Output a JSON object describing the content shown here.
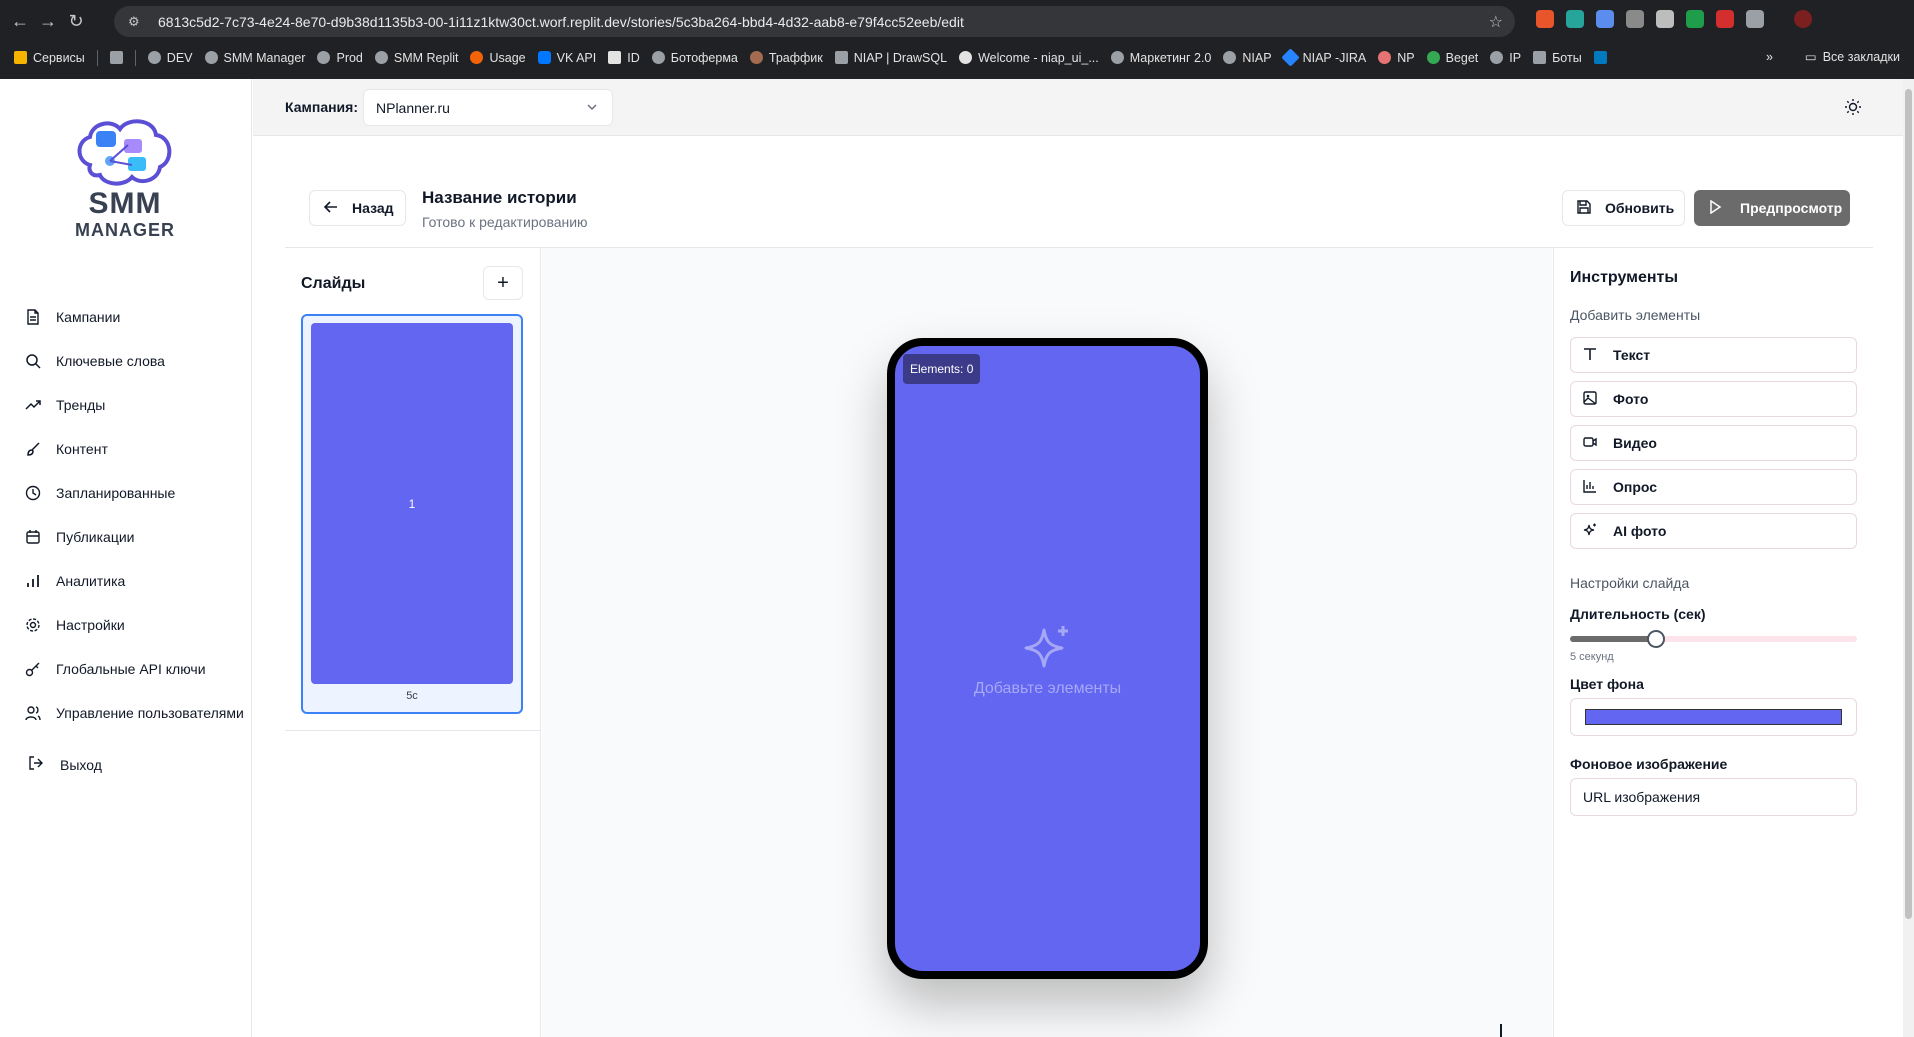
{
  "browser": {
    "url": "6813c5d2-7c73-4e24-8e70-d9b38d1135b3-00-1i11z1ktw30ct.worf.replit.dev/stories/5c3ba264-bbd4-4d32-aab8-e79f4cc52eeb/edit",
    "bookmarks": [
      "Сервисы",
      "DEV",
      "SMM Manager",
      "Prod",
      "SMM Replit",
      "Usage",
      "VK API",
      "ID",
      "Ботоферма",
      "Траффик",
      "NIAP | DrawSQL",
      "Welcome - niap_ui_...",
      "Маркетинг 2.0",
      "NIAP",
      "NIAP -JIRA",
      "NP",
      "Beget",
      "IP",
      "Боты"
    ],
    "all_bookmarks": "Все закладки"
  },
  "sidebar": {
    "logo": {
      "line1": "SMM",
      "line2": "MANAGER"
    },
    "items": [
      {
        "label": "Кампании",
        "icon": "file-icon"
      },
      {
        "label": "Ключевые слова",
        "icon": "search-icon"
      },
      {
        "label": "Тренды",
        "icon": "trending-icon"
      },
      {
        "label": "Контент",
        "icon": "brush-icon"
      },
      {
        "label": "Запланированные",
        "icon": "clock-icon"
      },
      {
        "label": "Публикации",
        "icon": "calendar-icon"
      },
      {
        "label": "Аналитика",
        "icon": "bar-chart-icon"
      },
      {
        "label": "Настройки",
        "icon": "gear-icon"
      },
      {
        "label": "Глобальные API ключи",
        "icon": "key-icon"
      },
      {
        "label": "Управление пользователями",
        "icon": "users-icon"
      }
    ],
    "logout": "Выход"
  },
  "topbar": {
    "campaign_label": "Кампания:",
    "campaign_value": "NPlanner.ru"
  },
  "header": {
    "back_label": "Назад",
    "title": "Название истории",
    "status": "Готово к редактированию",
    "update_label": "Обновить",
    "preview_label": "Предпросмотр"
  },
  "slides": {
    "title": "Слайды",
    "add_label": "+",
    "items": [
      {
        "number": "1",
        "duration": "5с",
        "color": "#6366f1"
      }
    ]
  },
  "canvas": {
    "elements_badge": "Elements: 0",
    "empty_message": "Добавьте элементы",
    "background": "#6366f1"
  },
  "tools": {
    "title": "Инструменты",
    "add_elements_label": "Добавить элементы",
    "buttons": [
      {
        "label": "Текст",
        "icon": "text-icon"
      },
      {
        "label": "Фото",
        "icon": "image-icon"
      },
      {
        "label": "Видео",
        "icon": "video-icon"
      },
      {
        "label": "Опрос",
        "icon": "poll-icon"
      },
      {
        "label": "AI фото",
        "icon": "sparkles-icon"
      }
    ],
    "slide_settings_label": "Настройки слайда",
    "duration_label": "Длительность (сек)",
    "duration_fraction": 0.3,
    "duration_value": "5 секунд",
    "bg_color_label": "Цвет фона",
    "bg_color": "#6366f1",
    "bg_image_label": "Фоновое изображение",
    "bg_image_placeholder": "URL изображения"
  }
}
